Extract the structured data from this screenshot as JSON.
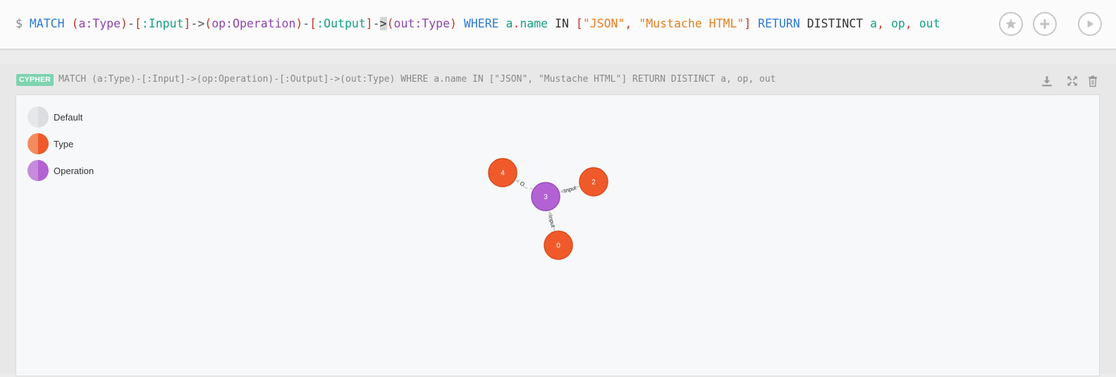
{
  "editor": {
    "tokens": [
      {
        "t": "$ ",
        "c": "tk-prompt"
      },
      {
        "t": "MATCH ",
        "c": "tk-kw"
      },
      {
        "t": "(",
        "c": "tk-paren"
      },
      {
        "t": "a",
        "c": "tk-label"
      },
      {
        "t": ":Type",
        "c": "tk-label"
      },
      {
        "t": ")",
        "c": "tk-paren"
      },
      {
        "t": "-",
        "c": "tk-dash"
      },
      {
        "t": "[",
        "c": "tk-paren"
      },
      {
        "t": ":Input",
        "c": "tk-rel"
      },
      {
        "t": "]",
        "c": "tk-paren"
      },
      {
        "t": "->",
        "c": "tk-dash"
      },
      {
        "t": "(",
        "c": "tk-paren"
      },
      {
        "t": "op:Operation",
        "c": "tk-label"
      },
      {
        "t": ")",
        "c": "tk-paren"
      },
      {
        "t": "-",
        "c": "tk-dash"
      },
      {
        "t": "[",
        "c": "tk-paren"
      },
      {
        "t": ":Output",
        "c": "tk-rel"
      },
      {
        "t": "]",
        "c": "tk-paren"
      },
      {
        "t": "-",
        "c": "tk-dash"
      },
      {
        "t": ">",
        "c": "tk-cursor"
      },
      {
        "t": "(",
        "c": "tk-paren"
      },
      {
        "t": "out:Type",
        "c": "tk-label"
      },
      {
        "t": ")",
        "c": "tk-paren"
      },
      {
        "t": " WHERE ",
        "c": "tk-kw"
      },
      {
        "t": "a",
        "c": "tk-var"
      },
      {
        "t": ".",
        "c": "tk-paren"
      },
      {
        "t": "name",
        "c": "tk-prop"
      },
      {
        "t": " IN ",
        "c": "tk-plain"
      },
      {
        "t": "[",
        "c": "tk-paren"
      },
      {
        "t": "\"JSON\"",
        "c": "tk-str"
      },
      {
        "t": ", ",
        "c": "tk-paren"
      },
      {
        "t": "\"Mustache HTML\"",
        "c": "tk-str"
      },
      {
        "t": "]",
        "c": "tk-paren"
      },
      {
        "t": " RETURN ",
        "c": "tk-kw"
      },
      {
        "t": "DISTINCT ",
        "c": "tk-plain"
      },
      {
        "t": "a",
        "c": "tk-var"
      },
      {
        "t": ", ",
        "c": "tk-paren"
      },
      {
        "t": "op",
        "c": "tk-var"
      },
      {
        "t": ", ",
        "c": "tk-paren"
      },
      {
        "t": "out",
        "c": "tk-var"
      }
    ],
    "buttons": [
      {
        "name": "favorite-button",
        "icon": "star-icon"
      },
      {
        "name": "add-button",
        "icon": "plus-icon"
      },
      {
        "name": "run-button",
        "icon": "play-icon"
      }
    ]
  },
  "frame": {
    "badge": "CYPHER",
    "query": "MATCH (a:Type)-[:Input]->(op:Operation)-[:Output]->(out:Type) WHERE a.name IN [\"JSON\", \"Mustache HTML\"] RETURN DISTINCT a, op, out",
    "actions": [
      {
        "name": "download-button",
        "icon": "download-icon"
      },
      {
        "name": "expand-button",
        "icon": "expand-icon"
      },
      {
        "name": "delete-button",
        "icon": "trash-icon"
      }
    ]
  },
  "legend": [
    {
      "label": "Default",
      "color_light": "#e6e7e9",
      "color_dark": "#dcdde0"
    },
    {
      "label": "Type",
      "color_light": "#f48b5f",
      "color_dark": "#f05a2b"
    },
    {
      "label": "Operation",
      "color_light": "#c58bdc",
      "color_dark": "#b262d2"
    }
  ],
  "graph": {
    "nodes": [
      {
        "id": "4",
        "type": "Type",
        "fill": "#f05a2b",
        "stroke": "#d84b1f"
      },
      {
        "id": "3",
        "type": "Operation",
        "fill": "#b262d2",
        "stroke": "#9a4cbb"
      },
      {
        "id": "2",
        "type": "Type",
        "fill": "#f05a2b",
        "stroke": "#d84b1f"
      },
      {
        "id": "0",
        "type": "Type",
        "fill": "#f05a2b",
        "stroke": "#d84b1f"
      }
    ],
    "edges": [
      {
        "from": "3",
        "to": "4",
        "label": "O..."
      },
      {
        "from": "2",
        "to": "3",
        "label": "Input"
      },
      {
        "from": "0",
        "to": "3",
        "label": "Input"
      }
    ]
  }
}
